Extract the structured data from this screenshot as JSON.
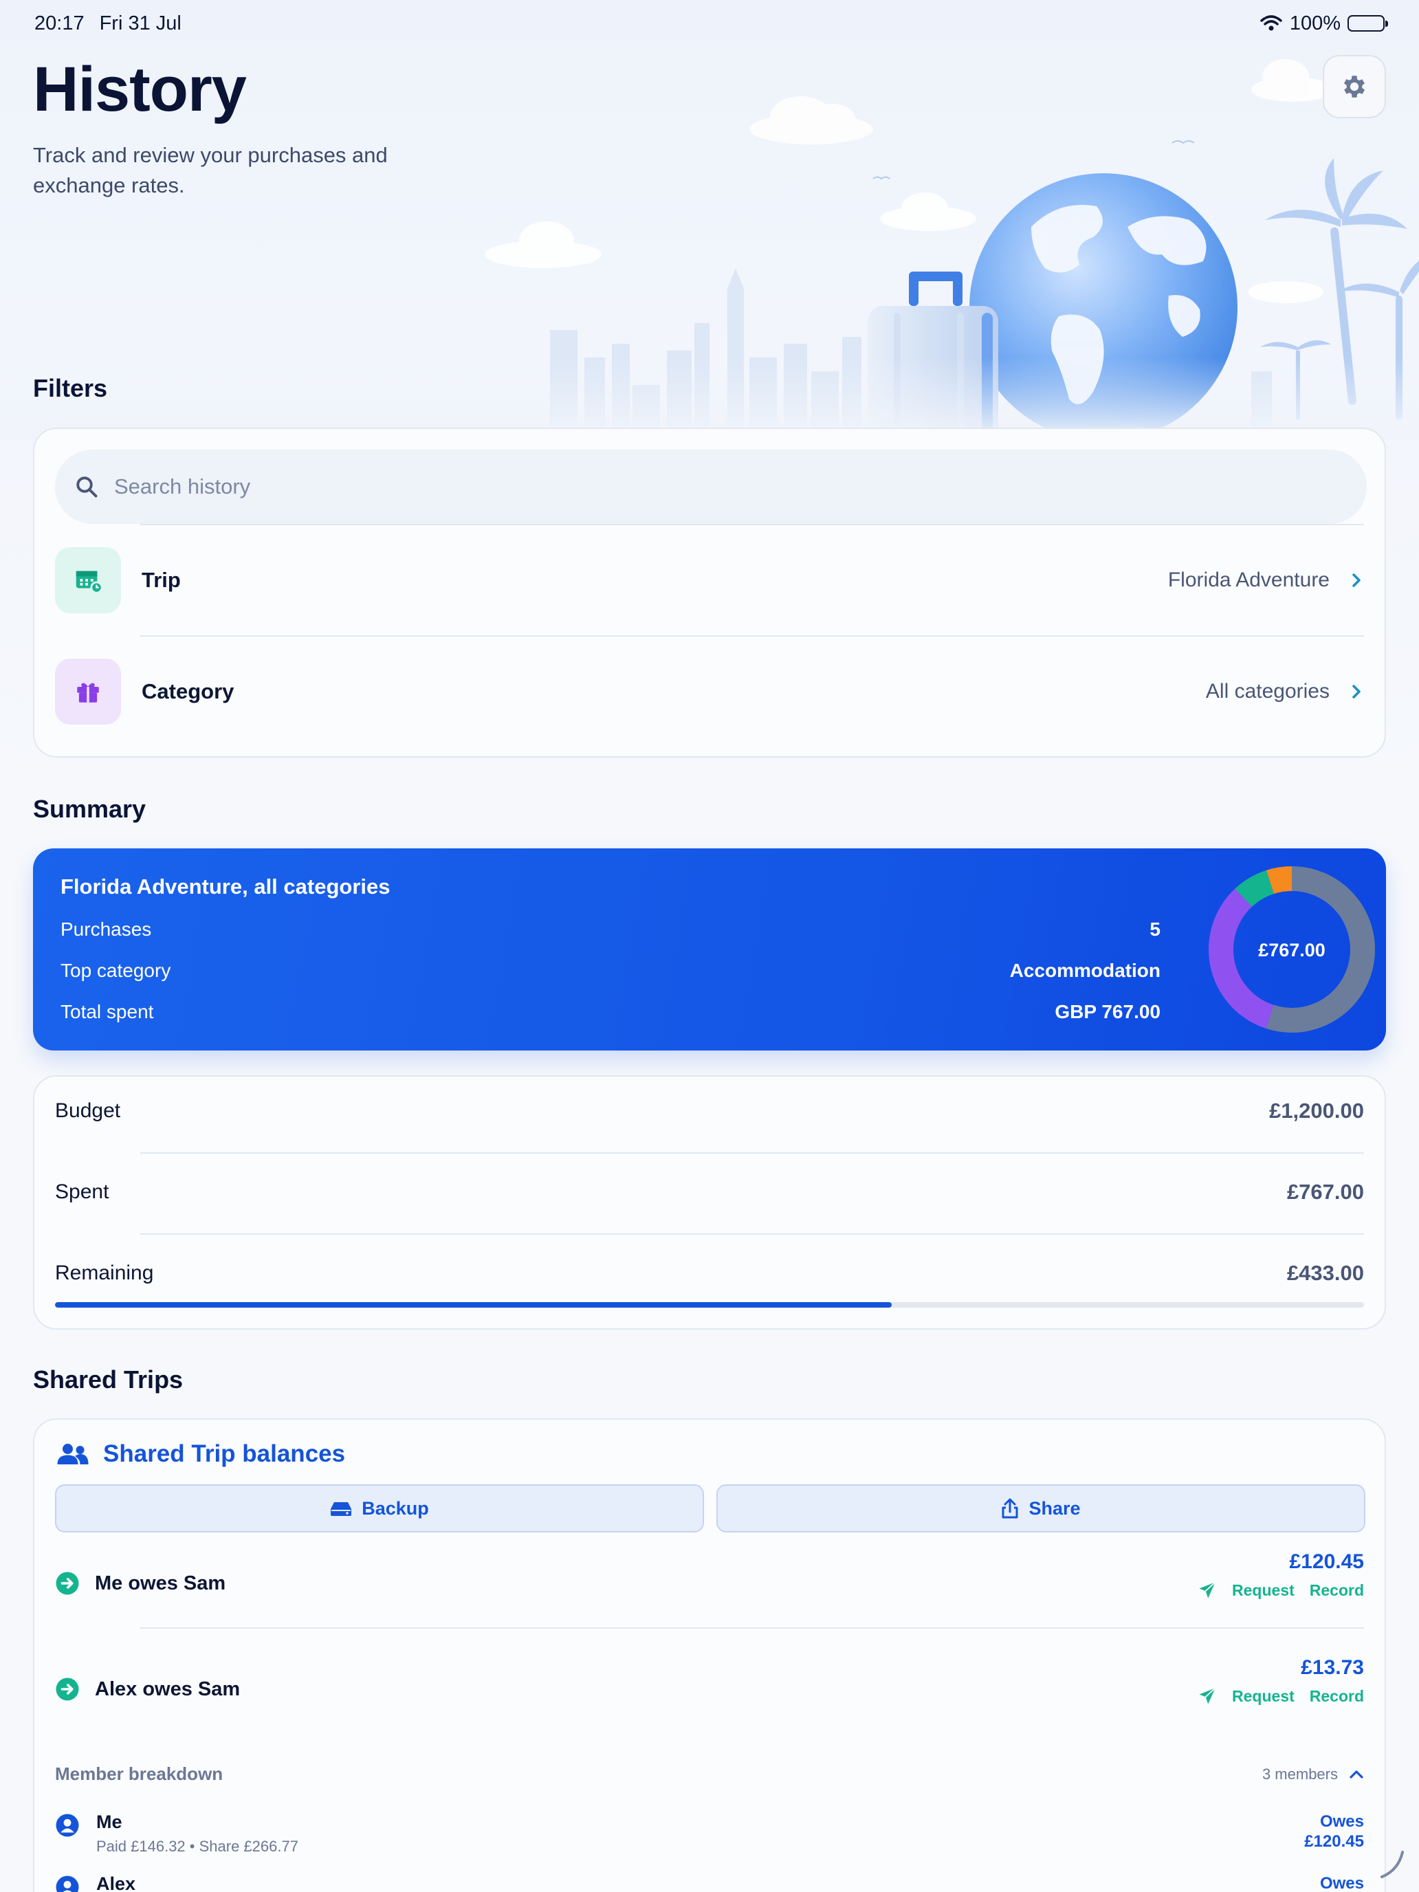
{
  "status_bar": {
    "time": "20:17",
    "date": "Fri 31 Jul",
    "battery": "100%"
  },
  "header": {
    "title": "History",
    "subtitle": "Track and review your purchases and exchange rates.",
    "settings_icon": "gear-icon"
  },
  "filters": {
    "section_title": "Filters",
    "search_placeholder": "Search history",
    "trip": {
      "label": "Trip",
      "value": "Florida Adventure",
      "icon": "calendar-icon",
      "icon_bg": "#dff5ef",
      "icon_color": "#17b38f"
    },
    "category": {
      "label": "Category",
      "value": "All categories",
      "icon": "gift-icon",
      "icon_bg": "#efe4fc",
      "icon_color": "#8a3ee8"
    }
  },
  "summary": {
    "section_title": "Summary",
    "card_title": "Florida Adventure, all categories",
    "rows": [
      {
        "label": "Purchases",
        "value": "5"
      },
      {
        "label": "Top category",
        "value": "Accommodation"
      },
      {
        "label": "Total spent",
        "value": "GBP 767.00"
      }
    ],
    "donut_label": "£767.00",
    "donut_segments": [
      {
        "color": "#6c7d9c",
        "fraction": 0.55
      },
      {
        "color": "#8f52f0",
        "fraction": 0.33
      },
      {
        "color": "#14b48f",
        "fraction": 0.07
      },
      {
        "color": "#f58a1f",
        "fraction": 0.05
      }
    ]
  },
  "budget": {
    "rows": [
      {
        "label": "Budget",
        "value": "£1,200.00"
      },
      {
        "label": "Spent",
        "value": "£767.00"
      },
      {
        "label": "Remaining",
        "value": "£433.00"
      }
    ],
    "progress_fraction": 0.639,
    "bar_color": "#1555d9"
  },
  "shared": {
    "section_title": "Shared Trips",
    "card_title": "Shared Trip balances",
    "backup_label": "Backup",
    "share_label": "Share",
    "debts": [
      {
        "text": "Me owes Sam",
        "amount": "£120.45",
        "request": "Request",
        "record": "Record"
      },
      {
        "text": "Alex owes Sam",
        "amount": "£13.73",
        "request": "Request",
        "record": "Record"
      }
    ],
    "member_breakdown": {
      "title": "Member breakdown",
      "count": "3 members",
      "members": [
        {
          "name": "Me",
          "detail": "Paid £146.32 • Share £266.77",
          "status": "Owes",
          "amount": "£120.45"
        },
        {
          "name": "Alex",
          "detail": "",
          "status": "Owes",
          "amount": ""
        }
      ]
    }
  },
  "colors": {
    "accent": "#1454d8",
    "teal": "#14b48f",
    "summary_blue": "#1456e6"
  }
}
